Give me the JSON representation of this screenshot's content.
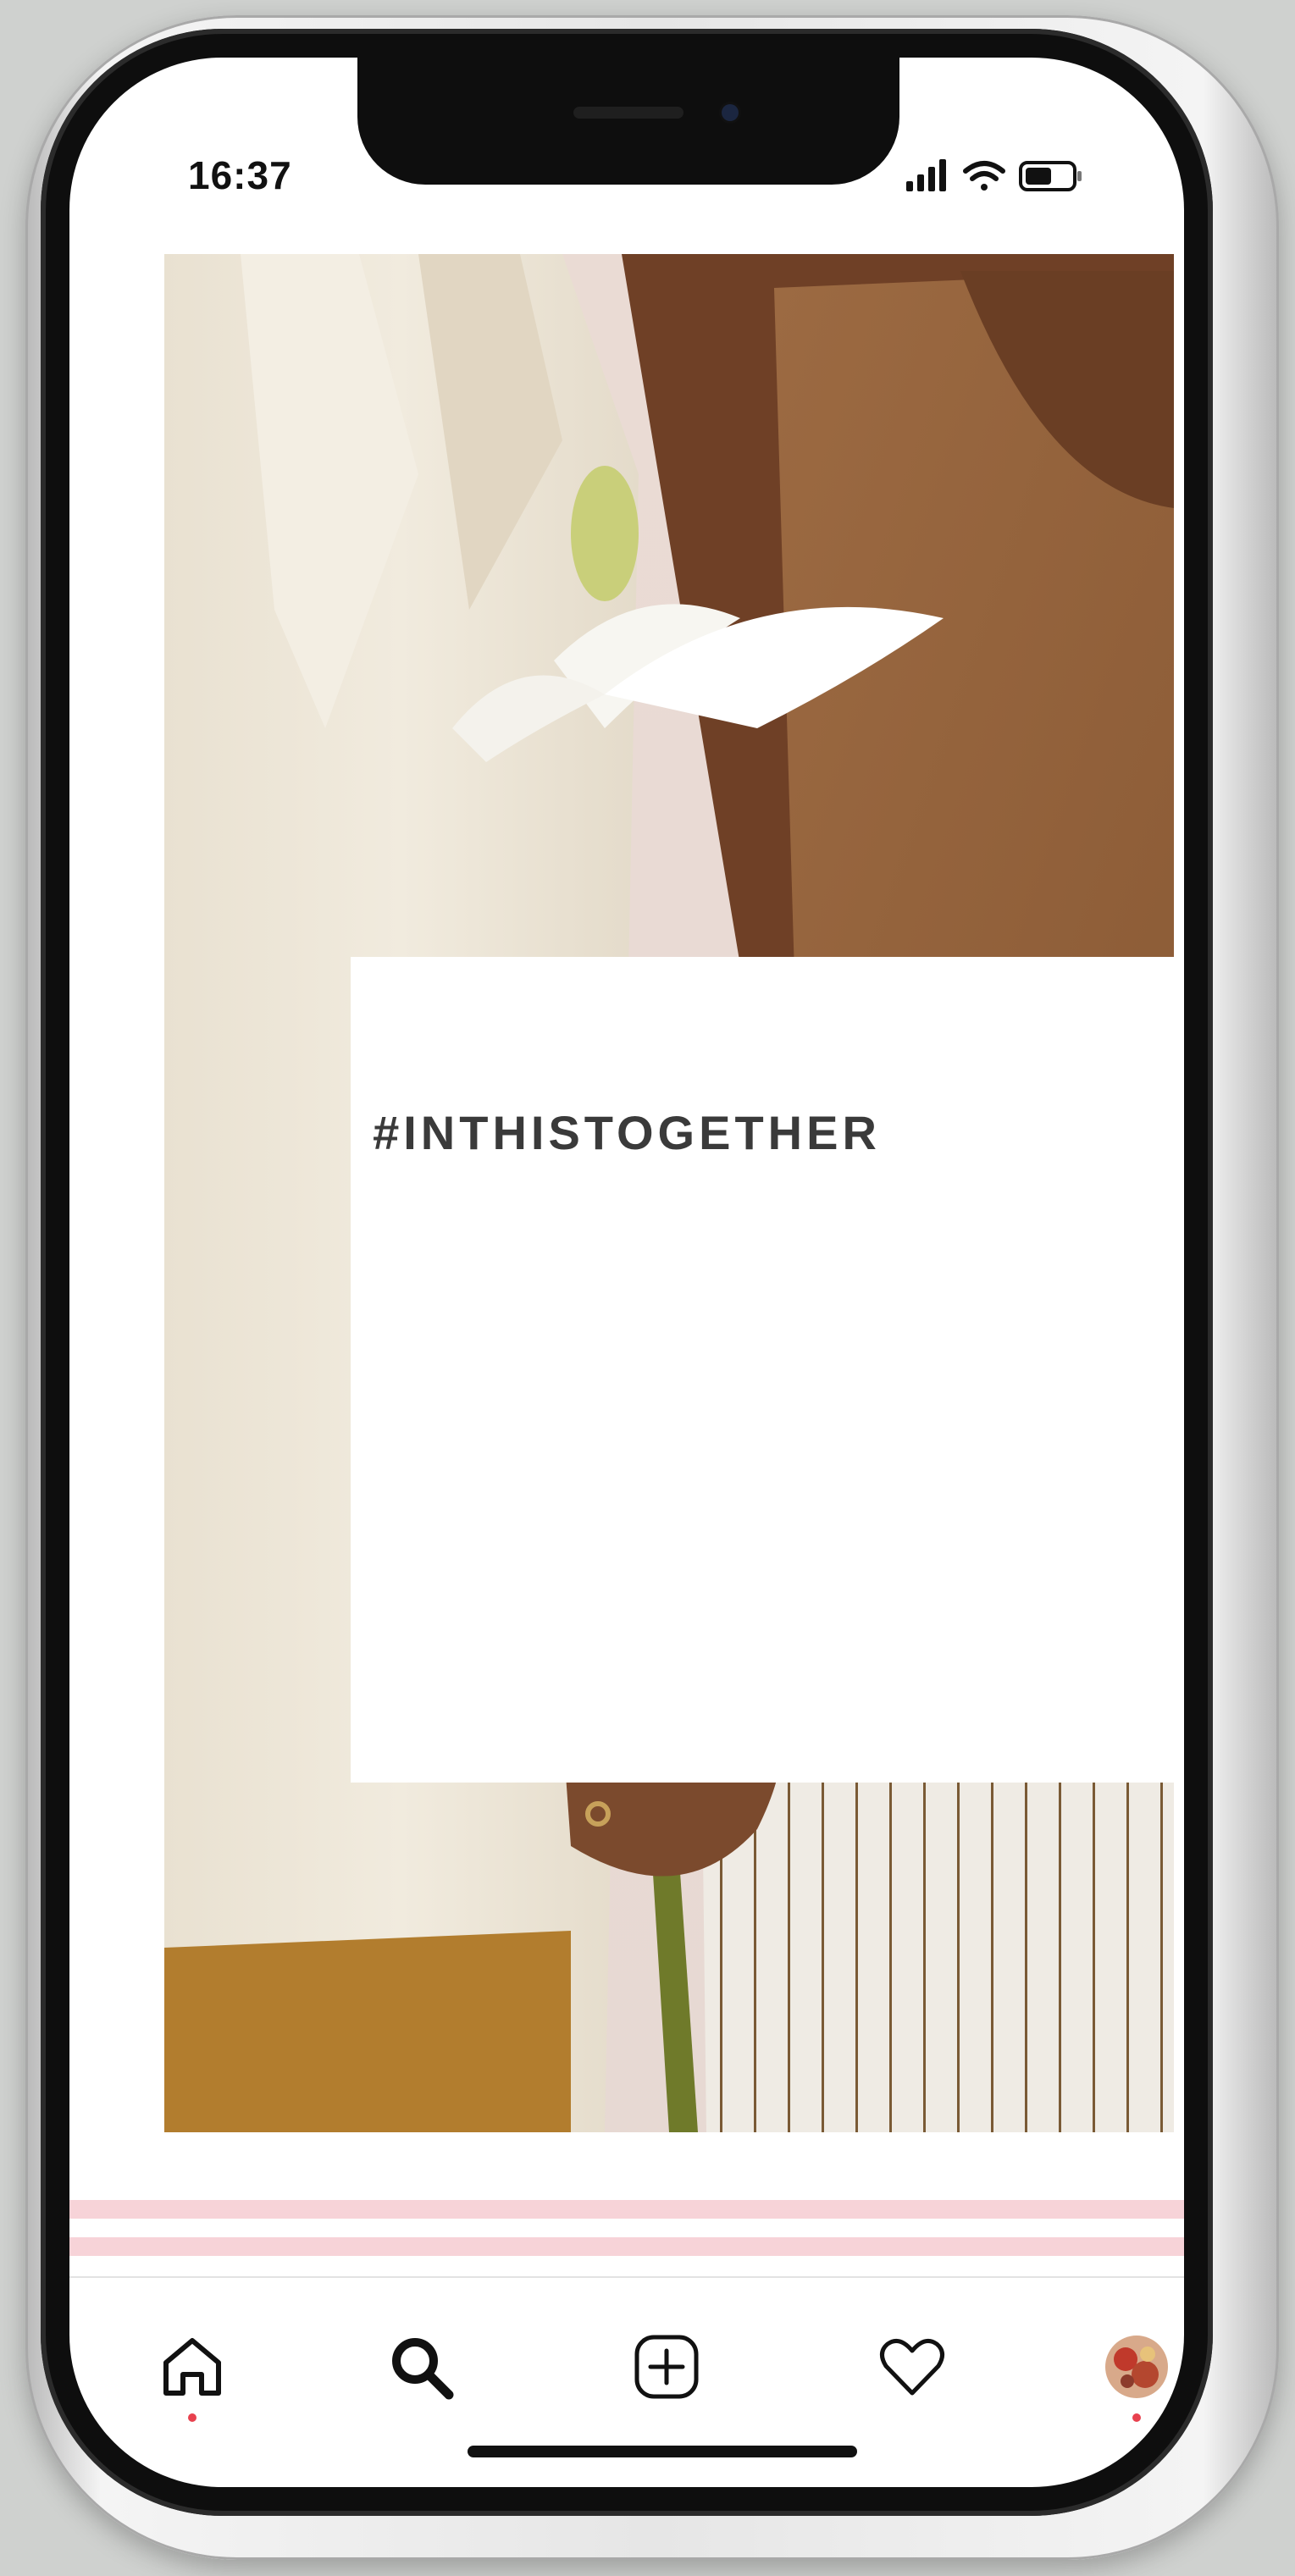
{
  "status_bar": {
    "time": "16:37",
    "icons": [
      "cellular-signal-icon",
      "wifi-icon",
      "battery-icon"
    ]
  },
  "post": {
    "hashtag": "#INTHISTOGETHER"
  },
  "bottom_nav": {
    "items": [
      {
        "icon": "home-icon",
        "active": true
      },
      {
        "icon": "search-icon",
        "active": false
      },
      {
        "icon": "add-post-icon",
        "active": false
      },
      {
        "icon": "heart-icon",
        "active": false
      },
      {
        "icon": "profile-avatar-icon",
        "active": false
      }
    ]
  },
  "colors": {
    "accent_dot": "#e8414e",
    "stripe_pink": "#f7d3d8",
    "card_background": "#ffffff",
    "text_dark": "#3a3a3a"
  }
}
